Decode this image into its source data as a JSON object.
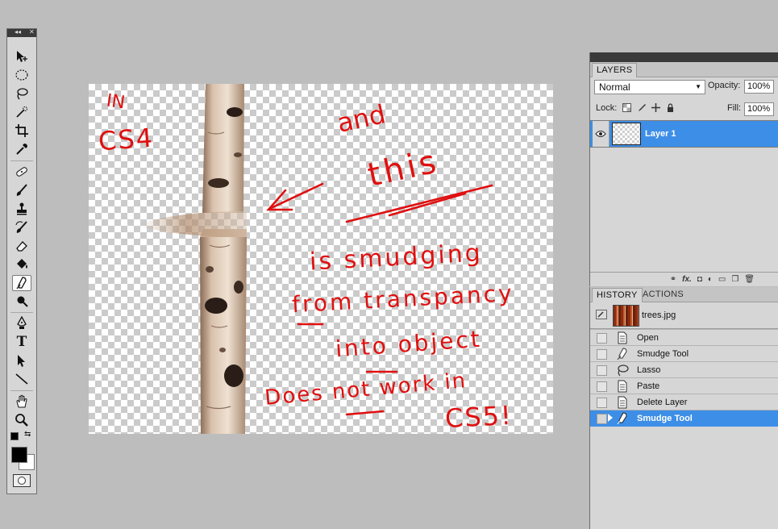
{
  "tools_panel": {
    "collapse_glyph": "◂◂",
    "close_glyph": "✕",
    "tools": [
      {
        "name": "move-tool",
        "icon": "move-icon"
      },
      {
        "name": "marquee-tool",
        "icon": "ellipse-marquee-icon"
      },
      {
        "name": "lasso-tool",
        "icon": "lasso-icon"
      },
      {
        "name": "quick-select-tool",
        "icon": "magic-wand-icon"
      },
      {
        "name": "crop-tool",
        "icon": "crop-icon"
      },
      {
        "name": "eyedropper-tool",
        "icon": "eyedropper-icon"
      },
      {
        "name": "healing-tool",
        "icon": "bandage-icon"
      },
      {
        "name": "brush-tool",
        "icon": "brush-icon"
      },
      {
        "name": "clone-stamp-tool",
        "icon": "stamp-icon"
      },
      {
        "name": "history-brush-tool",
        "icon": "history-brush-icon"
      },
      {
        "name": "eraser-tool",
        "icon": "eraser-icon"
      },
      {
        "name": "paint-bucket-tool",
        "icon": "bucket-icon"
      },
      {
        "name": "smudge-tool",
        "icon": "smudge-icon",
        "active": true
      },
      {
        "name": "dodge-tool",
        "icon": "dodge-icon"
      },
      {
        "name": "pen-tool",
        "icon": "pen-icon"
      },
      {
        "name": "type-tool",
        "icon": "type-icon"
      },
      {
        "name": "path-select-tool",
        "icon": "arrow-icon"
      },
      {
        "name": "line-tool",
        "icon": "line-icon"
      },
      {
        "name": "hand-tool",
        "icon": "hand-icon"
      },
      {
        "name": "zoom-tool",
        "icon": "zoom-icon"
      }
    ],
    "type_tool_glyph": "T",
    "foreground_color": "#000000",
    "background_color": "#ffffff"
  },
  "canvas": {
    "annotation_color": "#e01010",
    "handwritten_notes": [
      "IN",
      "CS4",
      "and",
      "this",
      "is smudging",
      "from transpancy",
      "into object",
      "Does not work in",
      "CS5!"
    ]
  },
  "layers_panel": {
    "tab_label": "LAYERS",
    "blend_mode": "Normal",
    "opacity_label": "Opacity:",
    "opacity_value": "100%",
    "lock_label": "Lock:",
    "fill_label": "Fill:",
    "fill_value": "100%",
    "layers": [
      {
        "name": "Layer 1",
        "selected": true
      }
    ],
    "footer_icons": [
      "link-icon",
      "fx-icon",
      "mask-icon",
      "adjustment-icon",
      "folder-icon",
      "new-layer-icon",
      "trash-icon"
    ],
    "fx_label": "fx."
  },
  "history_panel": {
    "tabs": [
      "HISTORY",
      "ACTIONS"
    ],
    "active_tab": "HISTORY",
    "snapshot": "trees.jpg",
    "items": [
      {
        "label": "Open",
        "icon": "document-icon"
      },
      {
        "label": "Smudge Tool",
        "icon": "smudge-icon"
      },
      {
        "label": "Lasso",
        "icon": "lasso-icon"
      },
      {
        "label": "Paste",
        "icon": "document-icon"
      },
      {
        "label": "Delete Layer",
        "icon": "document-icon"
      },
      {
        "label": "Smudge Tool",
        "icon": "smudge-icon",
        "active": true
      }
    ]
  }
}
